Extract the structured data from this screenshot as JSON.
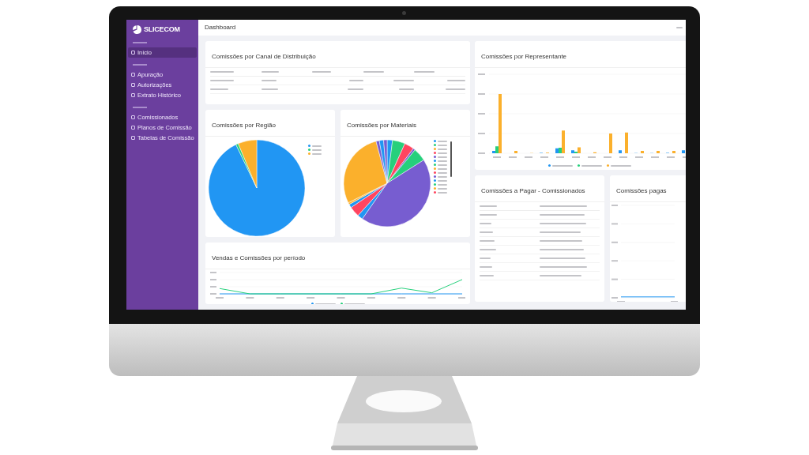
{
  "sidebar": {
    "logo": "SLICECOM",
    "sections": [
      {
        "items": [
          {
            "label": "Início",
            "selected": true
          }
        ]
      },
      {
        "items": [
          {
            "label": "Apuração",
            "selected": false
          },
          {
            "label": "Autorizações",
            "selected": false
          },
          {
            "label": "Extrato Histórico",
            "selected": false
          }
        ]
      },
      {
        "items": [
          {
            "label": "Comissionados",
            "selected": false
          },
          {
            "label": "Planos de Comissão",
            "selected": false
          },
          {
            "label": "Tabelas de Comissão",
            "selected": false
          }
        ]
      }
    ]
  },
  "header": {
    "title": "Dashboard"
  },
  "channel_table": {
    "title": "Comissões por Canal de Distribuição"
  },
  "region_pie": {
    "title": "Comissões por Região"
  },
  "material_pie": {
    "title": "Comissões por Materiais"
  },
  "period_chart": {
    "title": "Vendas e Comissões por período"
  },
  "rep_chart": {
    "title": "Comissões por Representante"
  },
  "payee_table": {
    "title": "Comissões a Pagar - Comissionados"
  },
  "paid_chart": {
    "title": "Comissões pagas"
  }
}
